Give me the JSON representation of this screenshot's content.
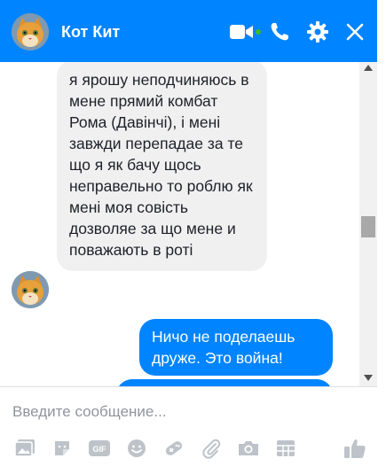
{
  "header": {
    "title": "Кот Кит",
    "color": "#0084ff"
  },
  "messages": [
    {
      "direction": "incoming",
      "text": "я ярошу неподчиняюсь в мене прямий комбат Рома (Давінчі), і мені завжди перепадае за те що я як бачу щось неправельно то роблю як мені моя совість дозволяе за що мене и поважають в роті"
    },
    {
      "direction": "outgoing",
      "text": "Ничо не поделаешь друже. Это война!"
    },
    {
      "direction": "outgoing",
      "text": ""
    }
  ],
  "composer": {
    "placeholder": "Введите сообщение..."
  },
  "icons": {
    "header": [
      "video-call-icon",
      "phone-icon",
      "settings-icon",
      "close-icon"
    ],
    "toolbar": [
      "photo-icon",
      "sticker-icon",
      "gif-icon",
      "emoji-icon",
      "game-icon",
      "attach-icon",
      "camera-icon",
      "table-icon",
      "like-icon"
    ]
  },
  "colors": {
    "accent": "#0084ff",
    "incoming_bubble": "#f1f0f0",
    "icon_gray": "#bec3c9"
  }
}
